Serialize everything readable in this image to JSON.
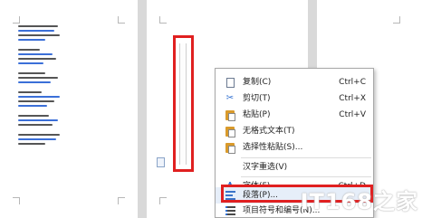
{
  "context_menu": {
    "items": [
      {
        "icon": "copy-icon",
        "label": "复制(C)",
        "shortcut": "Ctrl+C"
      },
      {
        "icon": "cut-icon",
        "label": "剪切(T)",
        "shortcut": "Ctrl+X"
      },
      {
        "icon": "paste-icon",
        "label": "粘贴(P)",
        "shortcut": "Ctrl+V"
      },
      {
        "icon": "paste-plain-icon",
        "label": "无格式文本(T)",
        "shortcut": ""
      },
      {
        "icon": "paste-special-icon",
        "label": "选择性粘贴(S)...",
        "shortcut": ""
      },
      {
        "icon": "",
        "label": "汉字重选(V)",
        "shortcut": ""
      },
      {
        "icon": "font-icon",
        "label": "字体(F)...",
        "shortcut": "Ctrl+D"
      },
      {
        "icon": "paragraph-icon",
        "label": "段落(P)...",
        "shortcut": ""
      },
      {
        "icon": "bullets-numbering-icon",
        "label": "项目符号和编号(N)...",
        "shortcut": ""
      }
    ],
    "highlighted_item": "段落(P)..."
  },
  "watermark": "IT168之家",
  "colors": {
    "highlight_border": "#e02020",
    "hover_bg": "#e6eef9",
    "link_blue": "#3b6fd8"
  }
}
